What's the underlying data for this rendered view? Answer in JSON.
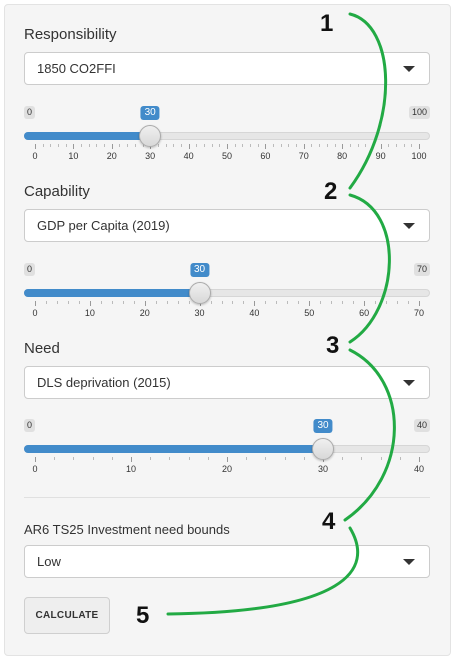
{
  "responsibility": {
    "label": "Responsibility",
    "select_value": "1850 CO2FFI",
    "slider": {
      "min": 0,
      "max": 100,
      "value": 30,
      "ticks": [
        0,
        10,
        20,
        30,
        40,
        50,
        60,
        70,
        80,
        90,
        100
      ]
    }
  },
  "capability": {
    "label": "Capability",
    "select_value": "GDP per Capita (2019)",
    "slider": {
      "min": 0,
      "max": 70,
      "value": 30,
      "ticks": [
        0,
        10,
        20,
        30,
        40,
        50,
        60,
        70
      ]
    }
  },
  "need": {
    "label": "Need",
    "select_value": "DLS deprivation (2015)",
    "slider": {
      "min": 0,
      "max": 40,
      "value": 30,
      "ticks": [
        0,
        10,
        20,
        30,
        40
      ]
    }
  },
  "investment": {
    "label": "AR6 TS25 Investment need bounds",
    "select_value": "Low"
  },
  "calculate_label": "CALCULATE",
  "steps": [
    "1",
    "2",
    "3",
    "4",
    "5"
  ],
  "colors": {
    "accent": "#428bca",
    "annotation": "#22aa44"
  }
}
